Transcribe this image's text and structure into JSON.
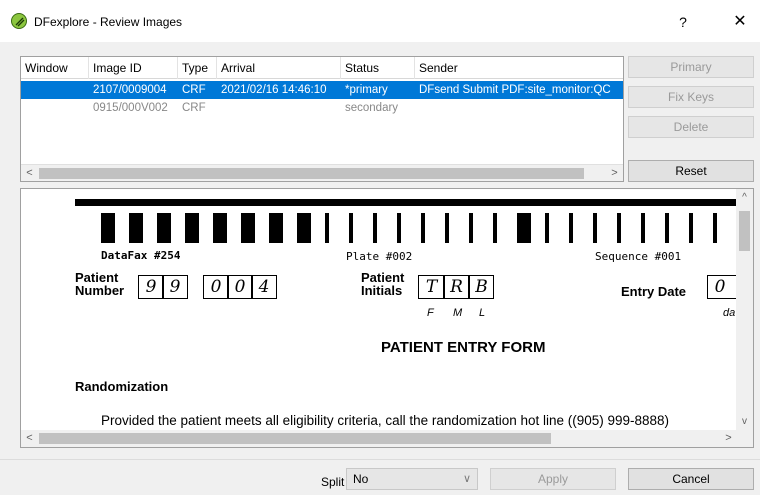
{
  "window": {
    "title": "DFexplore - Review Images",
    "help_label": "?",
    "close_label": "✕"
  },
  "table": {
    "columns": [
      "Window",
      "Image ID",
      "Type",
      "Arrival",
      "Status",
      "Sender"
    ],
    "rows": [
      {
        "window": "",
        "image_id": "2107/0009004",
        "type": "CRF",
        "arrival": "2021/02/16 14:46:10",
        "status": "*primary",
        "sender": "DFsend Submit PDF:site_monitor:QC",
        "selected": true
      },
      {
        "window": "",
        "image_id": "0915/000V002",
        "type": "CRF",
        "arrival": "",
        "status": "secondary",
        "sender": "",
        "selected": false
      }
    ],
    "scroll_left": "<",
    "scroll_right": ">"
  },
  "side_buttons": {
    "primary": "Primary",
    "fix_keys": "Fix Keys",
    "delete": "Delete",
    "reset": "Reset"
  },
  "form": {
    "datafax": "DataFax #254",
    "plate": "Plate #002",
    "sequence": "Sequence #001",
    "patient_number_label_1": "Patient",
    "patient_number_label_2": "Number",
    "patient_number_digits": [
      "9",
      "9",
      "0",
      "0",
      "4"
    ],
    "patient_initials_label_1": "Patient",
    "patient_initials_label_2": "Initials",
    "patient_initials": [
      "T",
      "R",
      "B"
    ],
    "initials_hints": [
      "F",
      "M",
      "L"
    ],
    "entry_date_label": "Entry Date",
    "entry_date_first_digit": "0",
    "entry_date_hint": "da",
    "title": "PATIENT ENTRY FORM",
    "section": "Randomization",
    "instruction": "Provided the patient meets all eligibility criteria, call the randomization hot line ((905) 999-8888)",
    "scroll_left": "<",
    "scroll_right": ">",
    "scroll_up": "^",
    "scroll_down": "v"
  },
  "bottom": {
    "split_label": "Split",
    "split_value": "No",
    "split_chevron": "∨",
    "apply": "Apply",
    "cancel": "Cancel"
  }
}
